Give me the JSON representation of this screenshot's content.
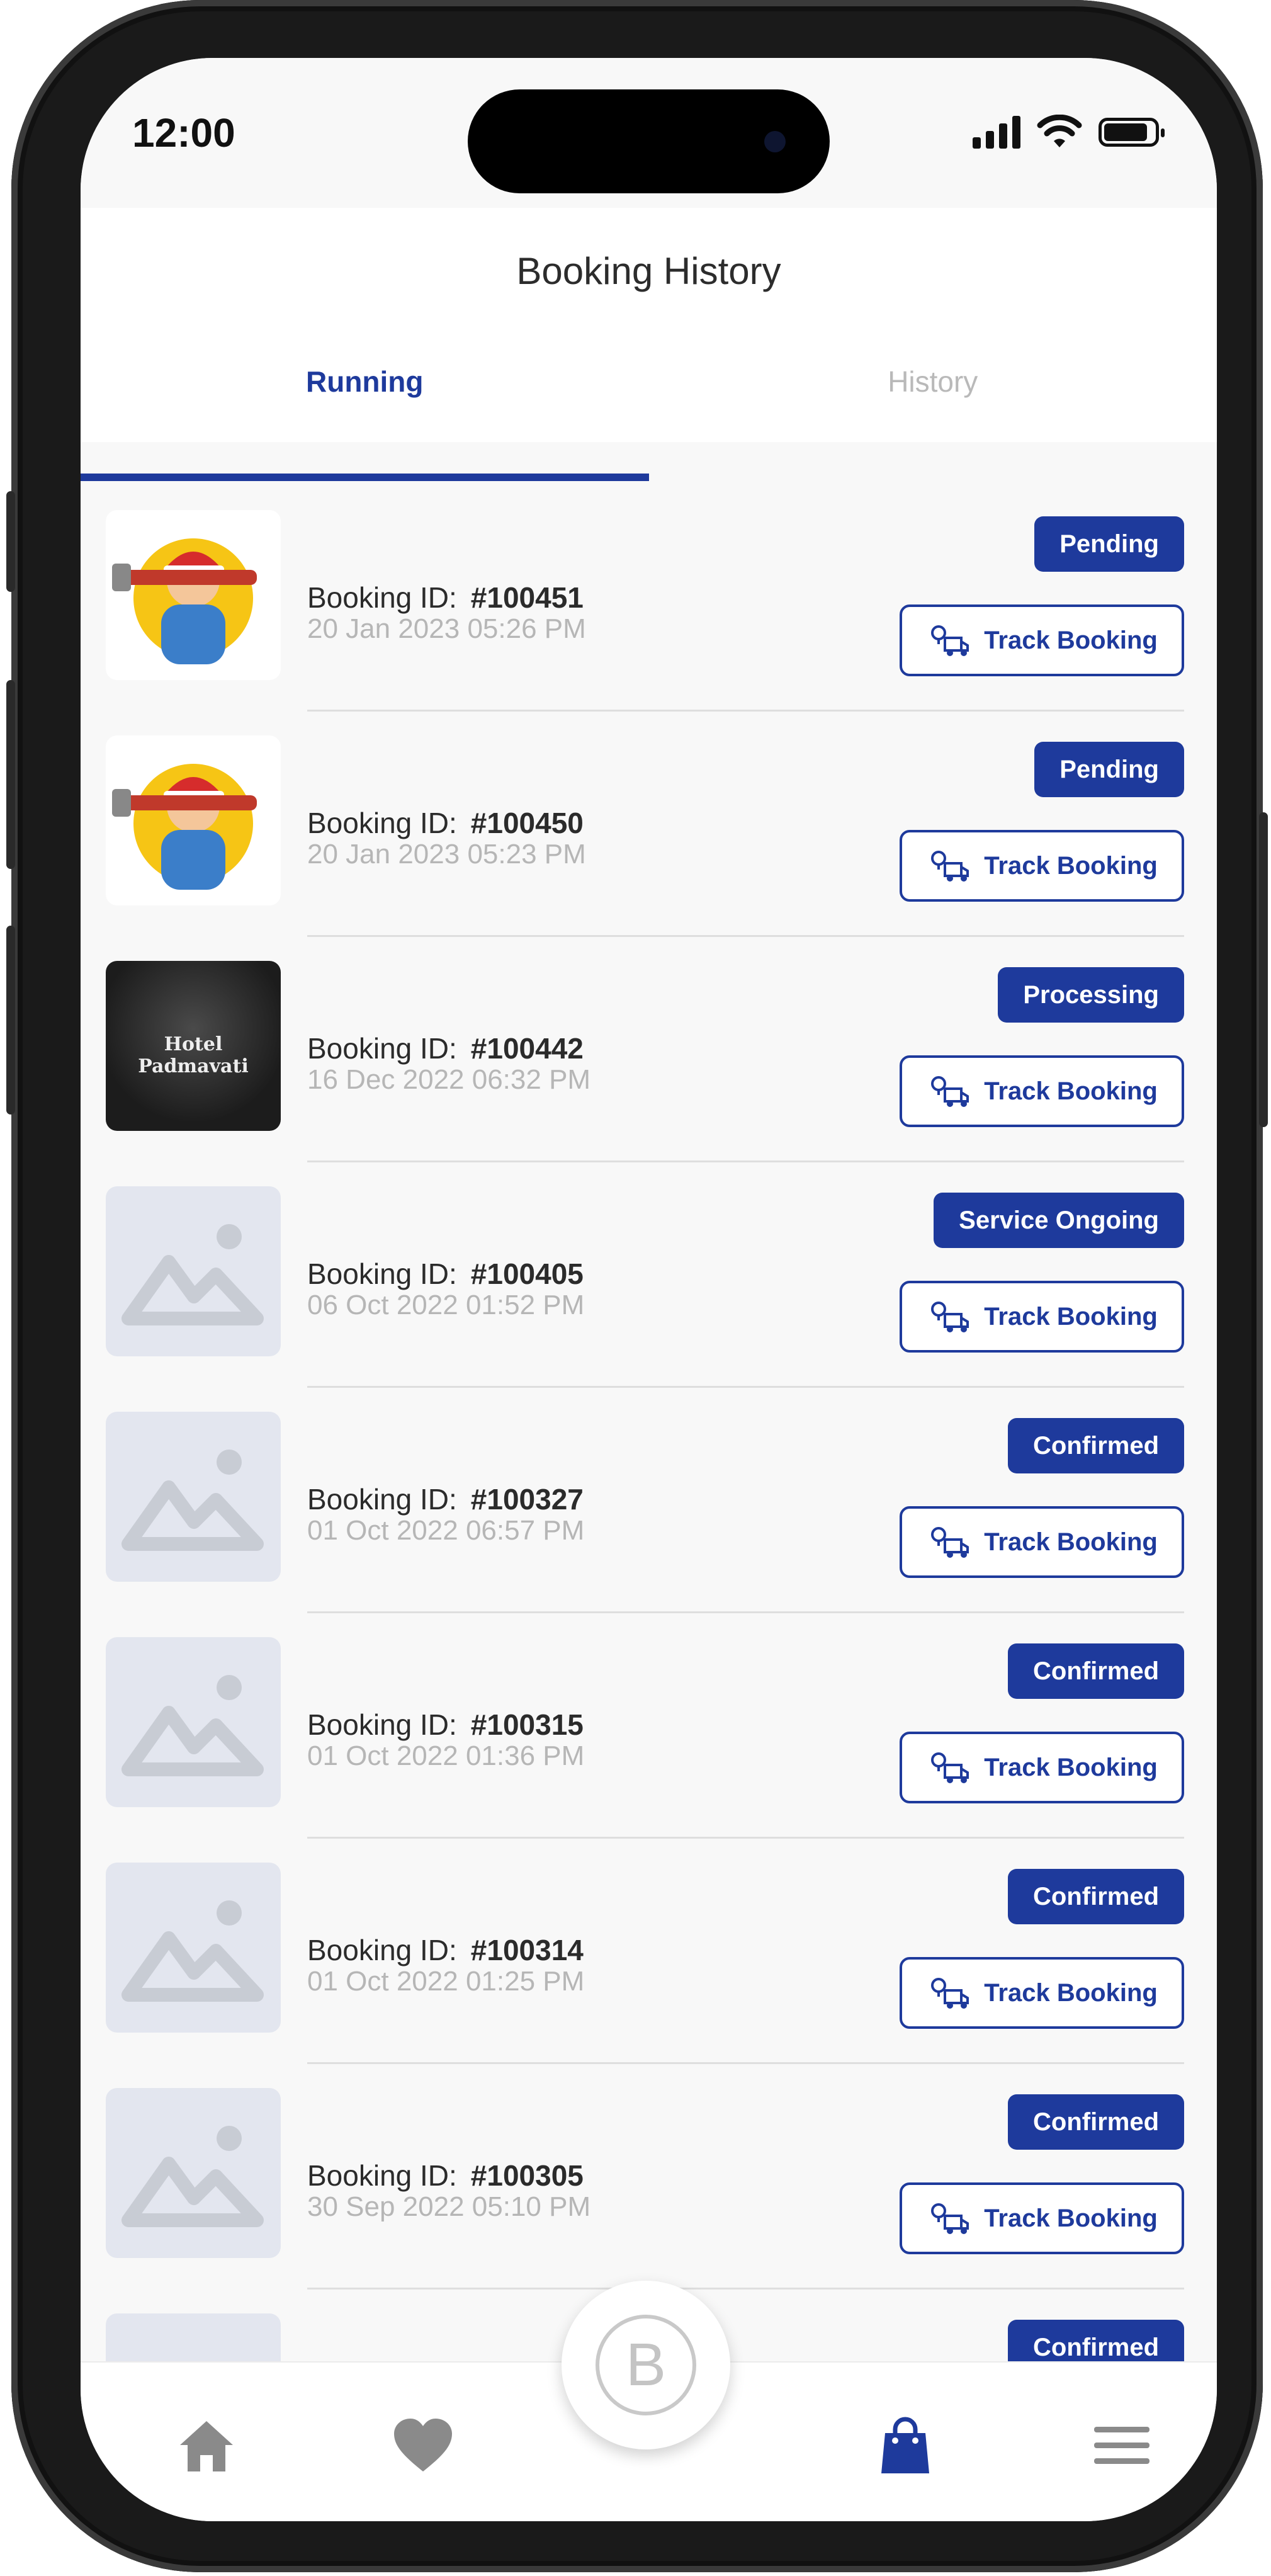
{
  "status_bar": {
    "time": "12:00"
  },
  "header": {
    "title": "Booking History"
  },
  "tabs": [
    {
      "label": "Running",
      "active": true
    },
    {
      "label": "History",
      "active": false
    }
  ],
  "colors": {
    "accent": "#1e3a9c",
    "muted": "#b6b6b6"
  },
  "bookings": [
    {
      "id_label": "Booking ID:",
      "id": "#100451",
      "date": "20 Jan 2023  05:26 PM",
      "status": "Pending",
      "action": "Track Booking",
      "thumb": "plumber"
    },
    {
      "id_label": "Booking ID:",
      "id": "#100450",
      "date": "20 Jan 2023  05:23 PM",
      "status": "Pending",
      "action": "Track Booking",
      "thumb": "plumber"
    },
    {
      "id_label": "Booking ID:",
      "id": "#100442",
      "date": "16 Dec 2022  06:32 PM",
      "status": "Processing",
      "action": "Track Booking",
      "thumb": "hotel",
      "thumb_text": "Hotel Padmavati"
    },
    {
      "id_label": "Booking ID:",
      "id": "#100405",
      "date": "06 Oct 2022  01:52 PM",
      "status": "Service Ongoing",
      "action": "Track Booking",
      "thumb": "placeholder"
    },
    {
      "id_label": "Booking ID:",
      "id": "#100327",
      "date": "01 Oct 2022  06:57 PM",
      "status": "Confirmed",
      "action": "Track Booking",
      "thumb": "placeholder"
    },
    {
      "id_label": "Booking ID:",
      "id": "#100315",
      "date": "01 Oct 2022  01:36 PM",
      "status": "Confirmed",
      "action": "Track Booking",
      "thumb": "placeholder"
    },
    {
      "id_label": "Booking ID:",
      "id": "#100314",
      "date": "01 Oct 2022  01:25 PM",
      "status": "Confirmed",
      "action": "Track Booking",
      "thumb": "placeholder"
    },
    {
      "id_label": "Booking ID:",
      "id": "#100305",
      "date": "30 Sep 2022  05:10 PM",
      "status": "Confirmed",
      "action": "Track Booking",
      "thumb": "placeholder"
    },
    {
      "status": "Confirmed",
      "thumb": "placeholder"
    }
  ],
  "bottom_nav": {
    "items": [
      {
        "icon": "home-icon"
      },
      {
        "icon": "heart-icon"
      },
      {
        "icon": "logo-b-icon",
        "center_letter": "B"
      },
      {
        "icon": "shopping-bag-icon",
        "active": true
      },
      {
        "icon": "menu-icon"
      }
    ]
  }
}
